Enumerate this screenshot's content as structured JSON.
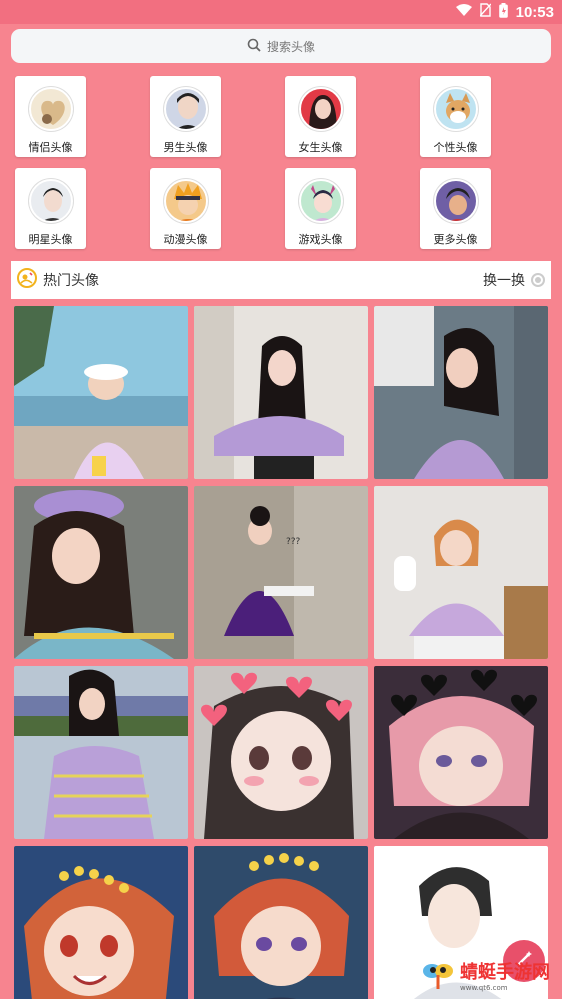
{
  "status_bar": {
    "time": "10:53",
    "icons": [
      "wifi-icon",
      "no-sim-icon",
      "battery-icon"
    ]
  },
  "search": {
    "placeholder": "搜索头像",
    "icon": "search-icon"
  },
  "categories": [
    {
      "label": "情侣头像",
      "color": "#e9d7b6"
    },
    {
      "label": "男生头像",
      "color": "#cfd6e6"
    },
    {
      "label": "女生头像",
      "color": "#e23a46"
    },
    {
      "label": "个性头像",
      "color": "#bfe3f1"
    },
    {
      "label": "明星头像",
      "color": "#dfe3e8"
    },
    {
      "label": "动漫头像",
      "color": "#f4c98a"
    },
    {
      "label": "游戏头像",
      "color": "#bfe8cf"
    },
    {
      "label": "更多头像",
      "color": "#6f5fa5"
    }
  ],
  "hot": {
    "title": "热门头像",
    "refresh": "换一换"
  },
  "watermark": {
    "text": "蜻蜓手游网",
    "sub": "www.qt6.com"
  },
  "colors": {
    "background": "#F7848F",
    "status_bar": "#F26F80"
  }
}
